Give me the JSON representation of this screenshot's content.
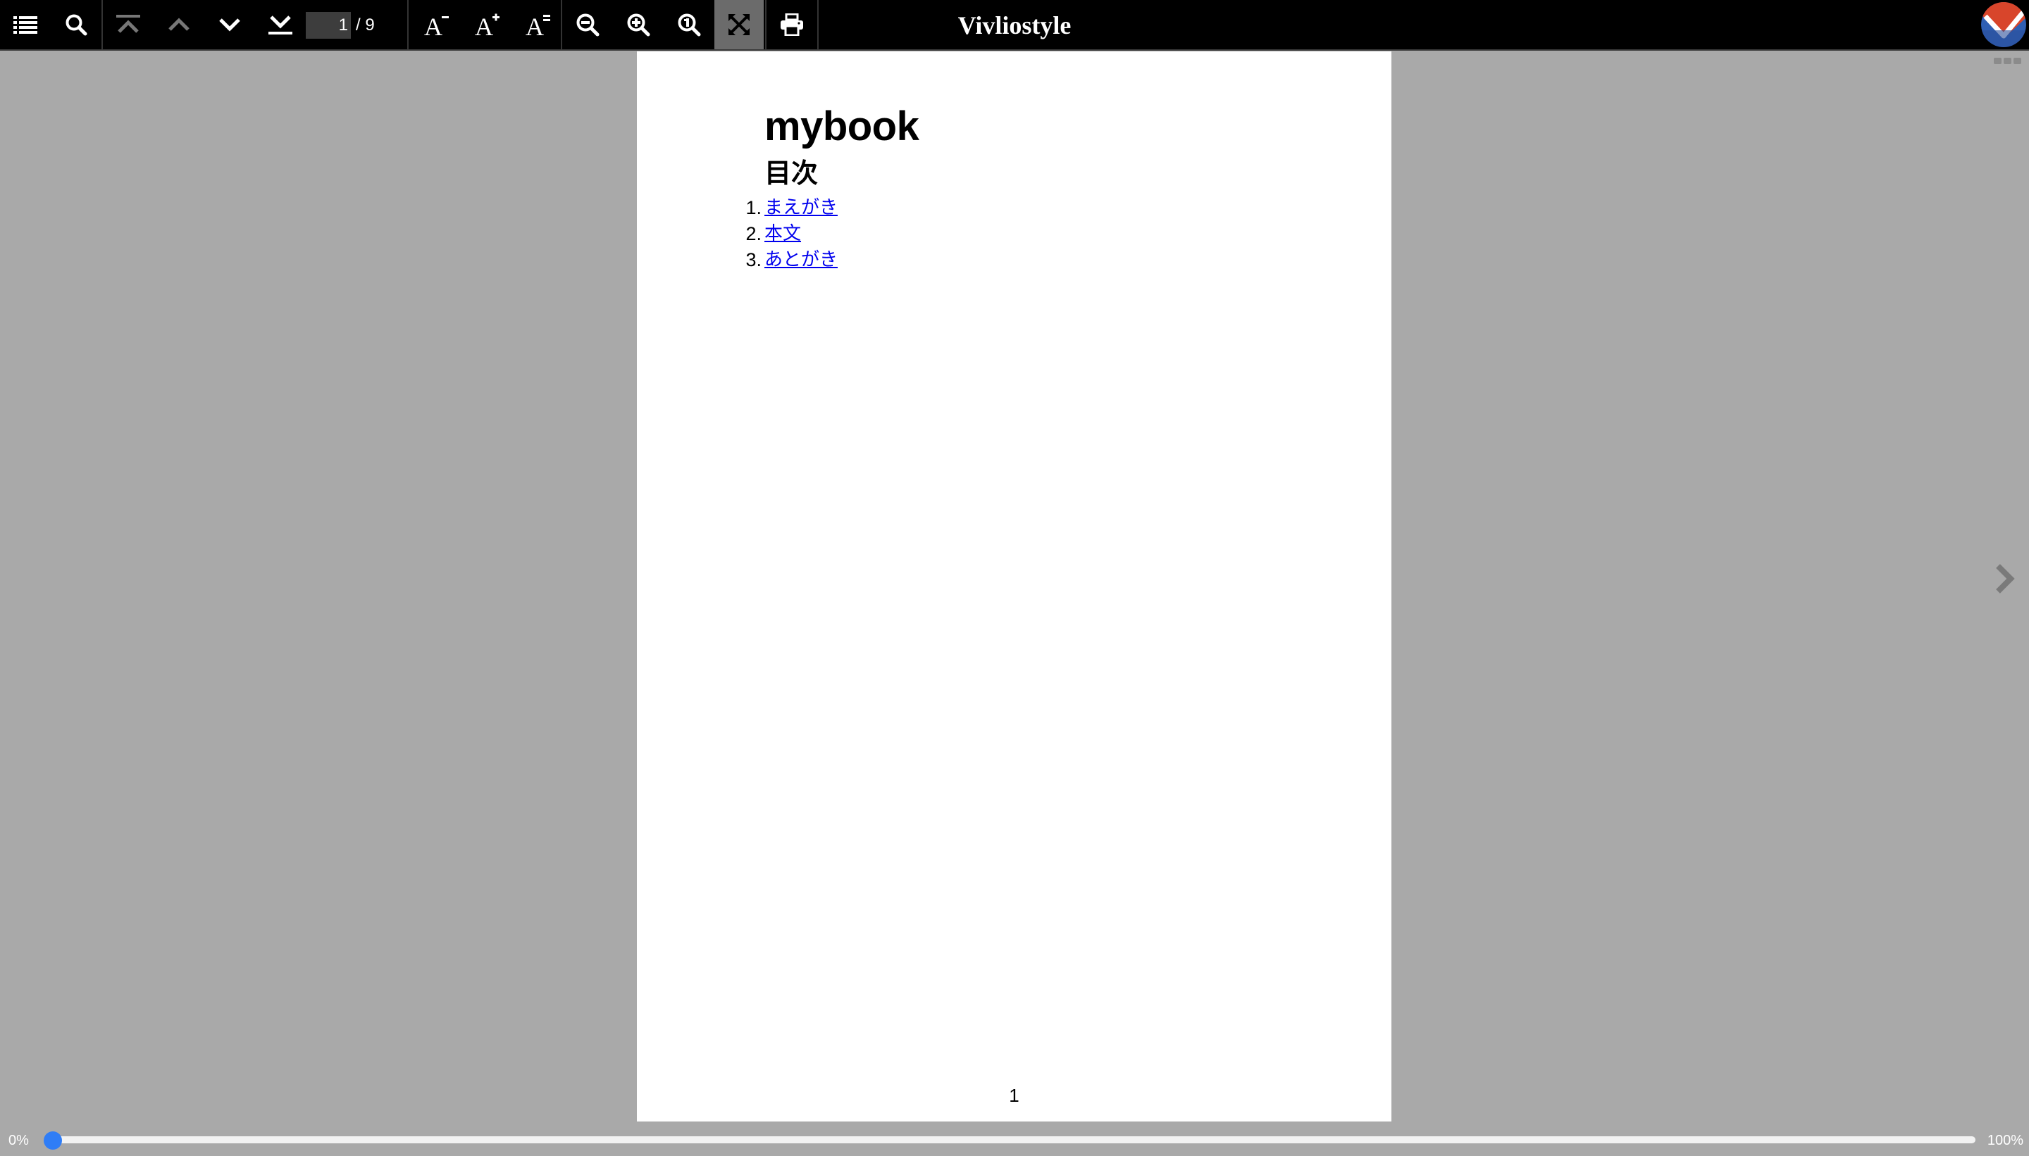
{
  "toolbar": {
    "buttons": [
      {
        "name": "toc-button",
        "icon": "list-icon",
        "state": "enabled"
      },
      {
        "name": "search-button",
        "icon": "search-icon",
        "state": "enabled"
      },
      {
        "name": "first-page-button",
        "icon": "first-page-icon",
        "state": "disabled"
      },
      {
        "name": "previous-page-button",
        "icon": "chevron-up-icon",
        "state": "disabled"
      },
      {
        "name": "next-page-button",
        "icon": "chevron-down-icon",
        "state": "enabled"
      },
      {
        "name": "last-page-button",
        "icon": "last-page-icon",
        "state": "enabled"
      },
      {
        "name": "decrease-font-button",
        "icon": "font-decrease-icon",
        "state": "enabled"
      },
      {
        "name": "increase-font-button",
        "icon": "font-increase-icon",
        "state": "enabled"
      },
      {
        "name": "default-font-button",
        "icon": "font-default-icon",
        "state": "enabled"
      },
      {
        "name": "zoom-out-button",
        "icon": "zoom-out-icon",
        "state": "enabled"
      },
      {
        "name": "zoom-in-button",
        "icon": "zoom-in-icon",
        "state": "enabled"
      },
      {
        "name": "zoom-actual-size-button",
        "icon": "zoom-actual-icon",
        "state": "enabled"
      },
      {
        "name": "fit-to-screen-button",
        "icon": "fit-screen-icon",
        "state": "active"
      },
      {
        "name": "print-button",
        "icon": "print-icon",
        "state": "enabled"
      }
    ],
    "page_input_value": "1",
    "page_total": "/ 9",
    "title": "Vivliostyle"
  },
  "document": {
    "title": "mybook",
    "toc_heading": "目次",
    "toc_items": [
      {
        "number": "1.",
        "label": "まえがき"
      },
      {
        "number": "2.",
        "label": "本文"
      },
      {
        "number": "3.",
        "label": "あとがき"
      }
    ],
    "page_number": "1"
  },
  "progress": {
    "min_label": "0%",
    "max_label": "100%",
    "value_percent": 0
  },
  "colors": {
    "toolbar_bg": "#000000",
    "viewer_bg": "#a9a9a9",
    "link": "#0000ee",
    "progress_thumb": "#2f7df6"
  }
}
